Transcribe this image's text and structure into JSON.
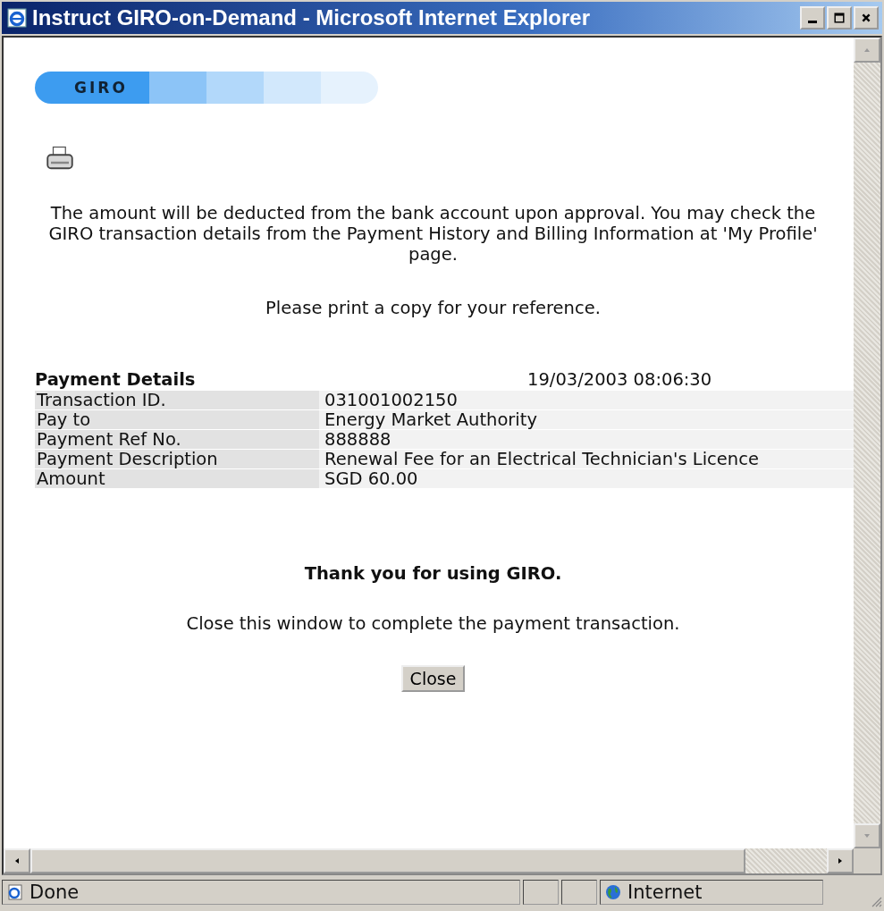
{
  "window": {
    "title": "Instruct GIRO-on-Demand - Microsoft Internet Explorer"
  },
  "banner": {
    "label": "GIRO"
  },
  "message": "The amount will be deducted from the bank account upon approval. You may check the GIRO transaction details from the Payment History and Billing Information at 'My Profile' page.",
  "print_note": "Please print a copy for your reference.",
  "details": {
    "heading": "Payment Details",
    "timestamp": "19/03/2003 08:06:30",
    "rows": [
      {
        "label": "Transaction ID.",
        "value": "031001002150"
      },
      {
        "label": "Pay to",
        "value": "Energy Market Authority"
      },
      {
        "label": "Payment Ref No.",
        "value": "888888"
      },
      {
        "label": "Payment Description",
        "value": "Renewal Fee for an Electrical Technician's Licence"
      },
      {
        "label": "Amount",
        "value": "SGD 60.00"
      }
    ]
  },
  "thanks": "Thank you for using GIRO.",
  "close_note": "Close this window to complete the payment transaction.",
  "close_button": "Close",
  "status_bar": {
    "status": "Done",
    "zone": "Internet"
  }
}
